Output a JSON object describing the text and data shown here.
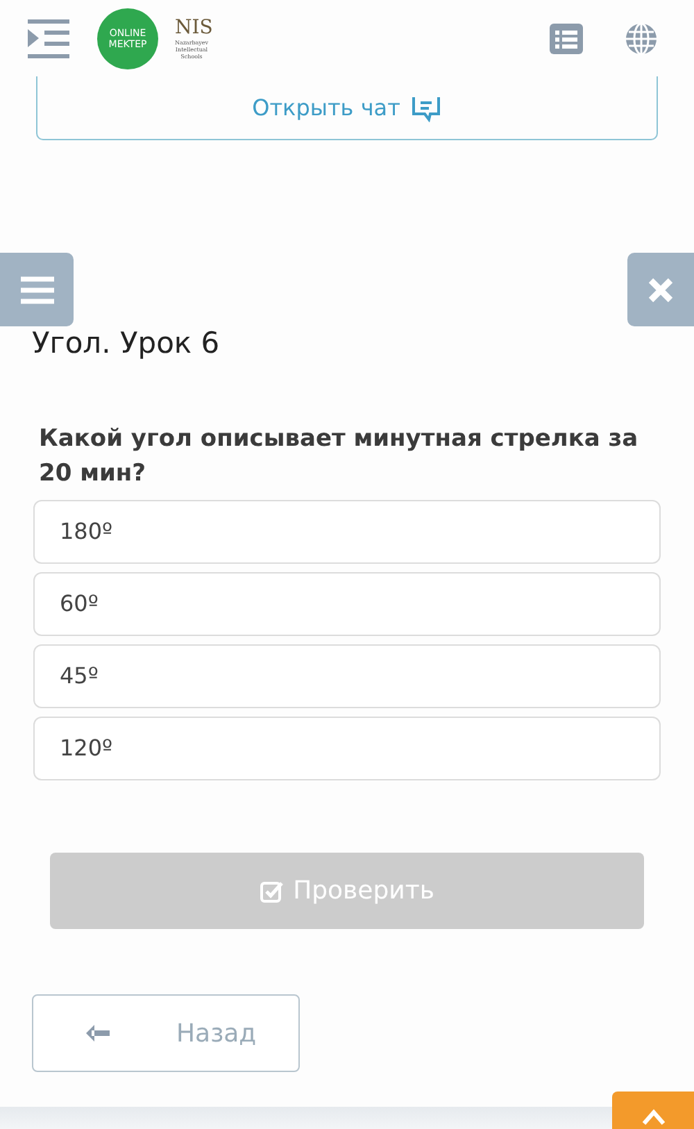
{
  "header": {
    "logo_text": "ONLINE MEKTEP",
    "brand": "NIS",
    "brand_sub": "Nazarbayev Intellectual Schools"
  },
  "chat_button": {
    "label": "Открыть чат"
  },
  "lesson_title": "Угол. Урок 6",
  "question": "Какой угол описывает минутная стрелка за 20 мин?",
  "options": [
    {
      "label": "180º",
      "selected": false
    },
    {
      "label": "60º",
      "selected": false
    },
    {
      "label": "45º",
      "selected": false
    },
    {
      "label": "120º",
      "selected": false
    }
  ],
  "check_button": {
    "label": "Проверить",
    "disabled": true
  },
  "back_button": {
    "label": "Назад"
  }
}
